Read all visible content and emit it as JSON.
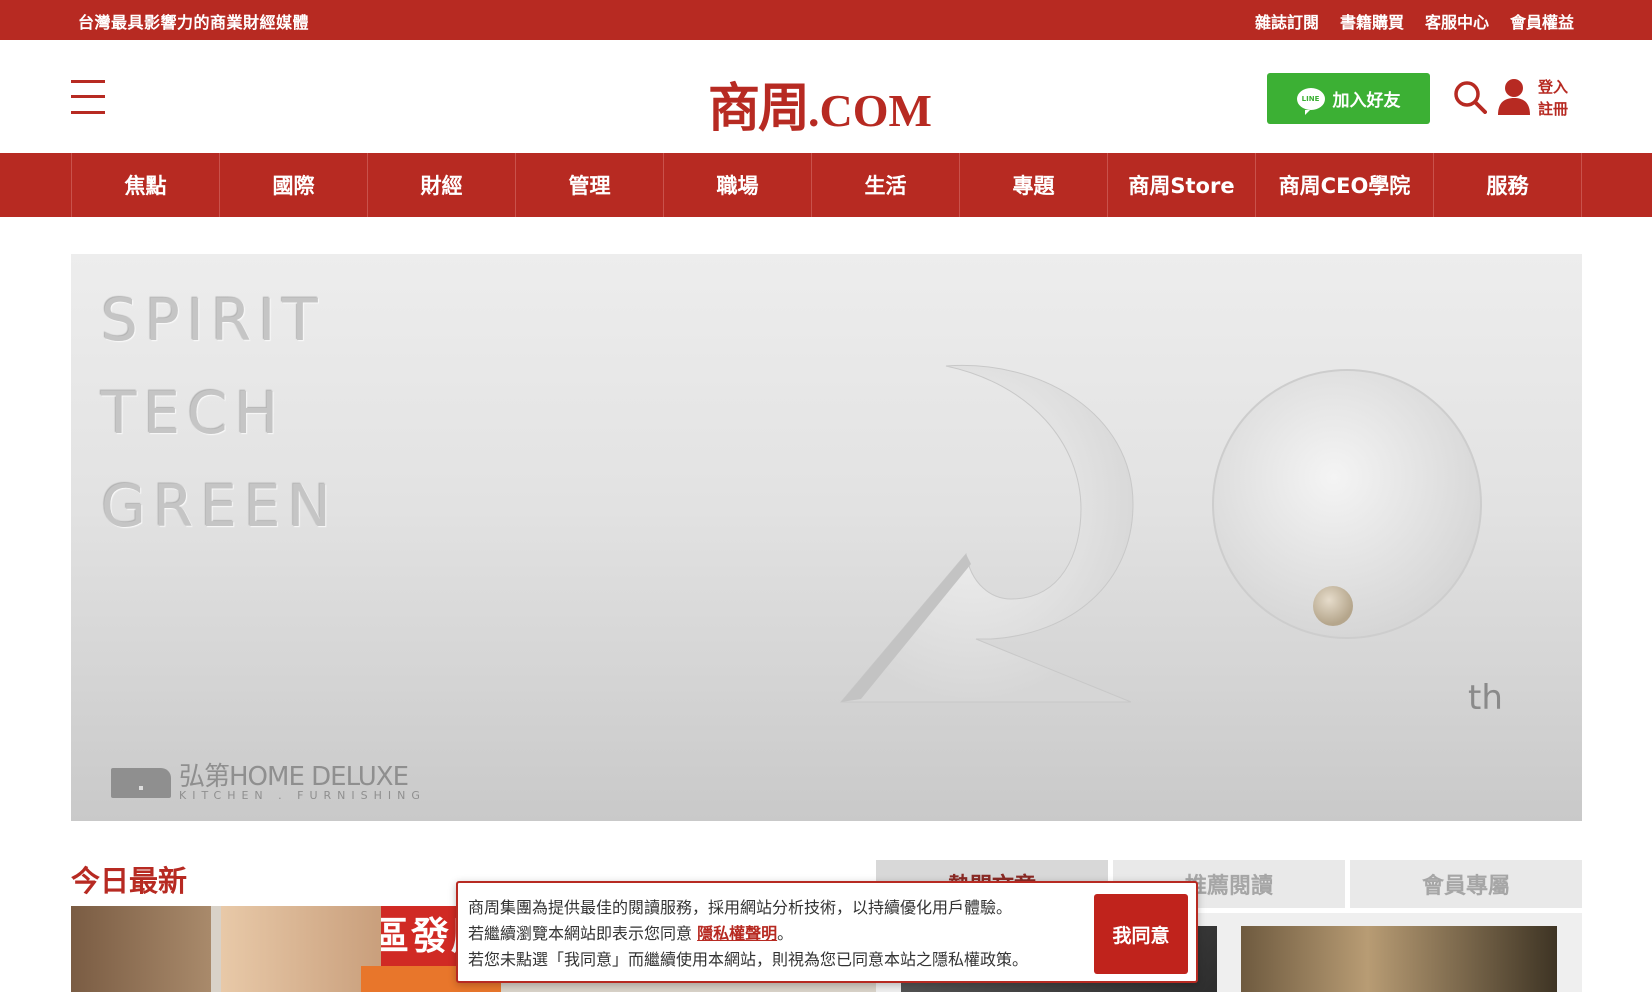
{
  "topbar": {
    "tagline": "台灣最具影響力的商業財經媒體",
    "links": [
      "雜誌訂閱",
      "書籍購買",
      "客服中心",
      "會員權益"
    ]
  },
  "header": {
    "logo_cn": "商周",
    "logo_com": ".COM",
    "line_icon_text": "LINE",
    "line_button": "加入好友",
    "login": "登入",
    "register": "註冊"
  },
  "nav": {
    "items": [
      {
        "label": "焦點"
      },
      {
        "label": "國際"
      },
      {
        "label": "財經"
      },
      {
        "label": "管理"
      },
      {
        "label": "職場"
      },
      {
        "label": "生活"
      },
      {
        "label": "專題"
      },
      {
        "label": "商周Store"
      },
      {
        "label": "商周CEO學院"
      },
      {
        "label": "服務"
      }
    ]
  },
  "banner": {
    "words": [
      "SPIRIT",
      "TECH",
      "GREEN"
    ],
    "suffix": "th",
    "brand_main": "弘第HOME DELUXE",
    "brand_sub": "KITCHEN . FURNISHING"
  },
  "latest": {
    "title": "今日最新",
    "image_banner_text": "社區發展協會"
  },
  "tabs": [
    {
      "label": "熱門文章"
    },
    {
      "label": "推薦閱讀"
    },
    {
      "label": "會員專屬"
    }
  ],
  "consent": {
    "line1": "商周集團為提供最佳的閱讀服務，採用網站分析技術，以持續優化用戶體驗。",
    "line2_pre": "若繼續瀏覽本網站即表示您同意 ",
    "privacy_link": "隱私權聲明",
    "line2_post": "。",
    "line3": "若您未點選「我同意」而繼續使用本網站，則視為您已同意本站之隱私權政策。",
    "agree_button": "我同意"
  },
  "colors": {
    "brand_red": "#b72a22",
    "line_green": "#3cb034"
  }
}
